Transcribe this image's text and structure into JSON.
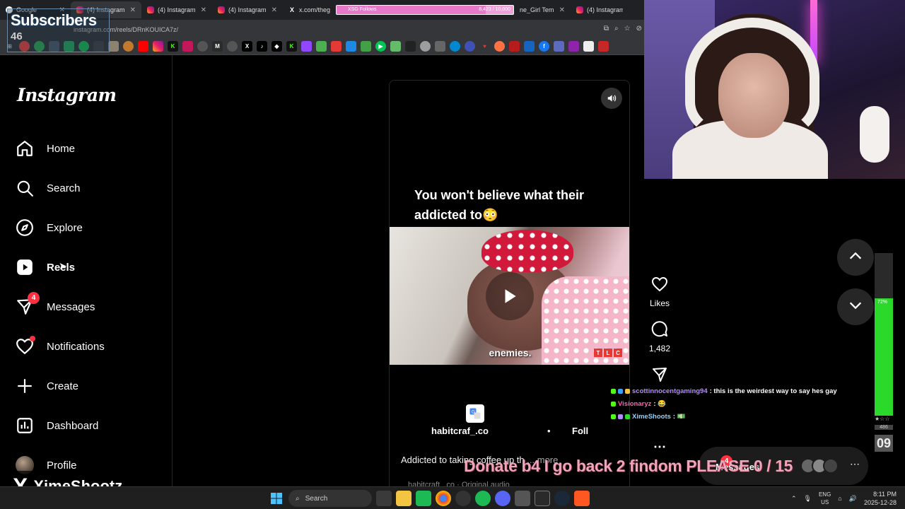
{
  "browser": {
    "tabs": [
      {
        "label": "Google",
        "icon": "google-icon",
        "active": false
      },
      {
        "label": "(4) Instagram",
        "icon": "instagram-icon",
        "active": true
      },
      {
        "label": "(4) Instagram",
        "icon": "instagram-icon",
        "active": false
      },
      {
        "label": "(4) Instagram",
        "icon": "instagram-icon",
        "active": false
      },
      {
        "label": "x.com/thegab",
        "icon": "x-icon",
        "active": false
      },
      {
        "label": "ne_Girl Tem",
        "icon": "generic-icon",
        "active": false
      },
      {
        "label": "(4) Instagram",
        "icon": "instagram-icon",
        "active": false
      }
    ],
    "url": "instagram.com/reels/DRnKOUICA7z/",
    "follow_goal": {
      "label": "XSG Follows",
      "progress_text": "8,423 / 10,000",
      "current": 8423,
      "goal": 10000
    }
  },
  "subscribers": {
    "title": "Subscribers",
    "count": "46"
  },
  "instagram": {
    "logo": "Instagram",
    "nav": [
      {
        "label": "Home",
        "icon": "home-icon"
      },
      {
        "label": "Search",
        "icon": "search-icon"
      },
      {
        "label": "Explore",
        "icon": "compass-icon"
      },
      {
        "label": "Reels",
        "icon": "reels-icon"
      },
      {
        "label": "Messages",
        "icon": "messenger-icon",
        "badge": "4"
      },
      {
        "label": "Notifications",
        "icon": "heart-icon",
        "dot": true
      },
      {
        "label": "Create",
        "icon": "plus-icon"
      },
      {
        "label": "Dashboard",
        "icon": "dashboard-icon"
      },
      {
        "label": "Profile",
        "icon": "avatar"
      }
    ]
  },
  "reel": {
    "caption_overlay": "You won't believe what their addicted to😳",
    "video_subtitle": "enemies.",
    "network_logo": [
      "T",
      "L",
      "C"
    ],
    "author": "habitcraf_.co",
    "follow_label": "Foll",
    "separator": "•",
    "description": "Addicted to taking coffee up th",
    "more_label": "... more",
    "audio": "habitcraft_.co · Original audio"
  },
  "actions": {
    "likes_label": "Likes",
    "comments_count": "1,482",
    "more_icon": "more-icon"
  },
  "chat": [
    {
      "user": "scottinnocentgaming94",
      "message": ": this is the weirdest way to say hes gay",
      "color": "#b58cff"
    },
    {
      "user": "Visionaryz",
      "message": ": 😂",
      "color": "#ff5fb3"
    },
    {
      "user": "XimeShoots",
      "message": ": 💵",
      "color": "#8fd3ff"
    }
  ],
  "donate_banner": "Donate b4 I go back 2 findom PLEASE 0 / 15",
  "messages_pill": {
    "label": "Messages",
    "badge": "4"
  },
  "volume_meter": {
    "percent_text": "72%",
    "level": 0.72,
    "count": "486",
    "big_number": "09"
  },
  "stream_handle": "XimeShootz",
  "taskbar": {
    "search_label": "Search",
    "lang_top": "ENG",
    "lang_bottom": "US",
    "time": "8:11 PM",
    "date": "2025-12-28"
  },
  "colors": {
    "accent_red": "#ff3040",
    "chat_pink": "#ff5fb3",
    "meter_green": "#2bd92b"
  }
}
